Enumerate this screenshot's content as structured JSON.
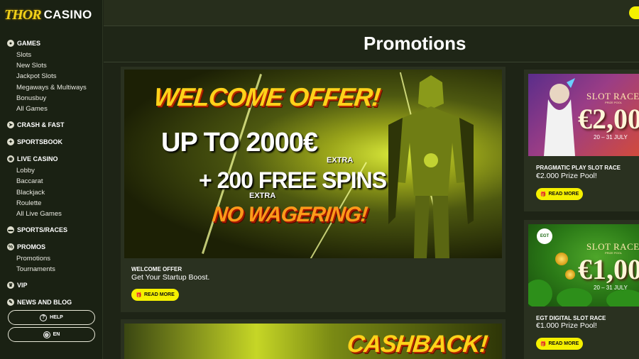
{
  "brand": {
    "logo_text_1": "THOR",
    "logo_text_2": "CASINO",
    "accent": "#f5f000"
  },
  "sidebar": {
    "sections": [
      {
        "label": "GAMES",
        "icon": "games-icon",
        "items": [
          "Slots",
          "New Slots",
          "Jackpot Slots",
          "Megaways & Multiways",
          "Bonusbuy",
          "All Games"
        ]
      },
      {
        "label": "CRASH & FAST",
        "icon": "rocket-icon",
        "items": []
      },
      {
        "label": "SPORTSBOOK",
        "icon": "sports-icon",
        "items": []
      },
      {
        "label": "LIVE CASINO",
        "icon": "live-casino-icon",
        "items": [
          "Lobby",
          "Baccarat",
          "Blackjack",
          "Roulette",
          "All Live Games"
        ]
      },
      {
        "label": "SPORTS/RACES",
        "icon": "races-icon",
        "items": []
      },
      {
        "label": "PROMOS",
        "icon": "promos-icon",
        "items": [
          "Promotions",
          "Tournaments"
        ]
      },
      {
        "label": "VIP",
        "icon": "vip-icon",
        "items": []
      },
      {
        "label": "NEWS AND BLOG",
        "icon": "news-icon",
        "items": []
      }
    ],
    "help_label": "HELP",
    "lang_label": "EN"
  },
  "page": {
    "title": "Promotions"
  },
  "promotions": [
    {
      "label": "WELCOME OFFER",
      "description": "Get Your Startup Boost.",
      "button": "READ MORE",
      "banner": {
        "headline": "WELCOME OFFER!",
        "line1": "UP TO 2000€",
        "line1_tag": "EXTRA",
        "line2": "+ 200 FREE SPINS",
        "line2_tag": "EXTRA",
        "line3": "NO WAGERING!"
      }
    },
    {
      "label": "",
      "description": "",
      "button": "",
      "banner": {
        "headline": "CASHBACK!"
      }
    }
  ],
  "races": [
    {
      "label": "PRAGMATIC PLAY SLOT RACE",
      "description": "€2.000 Prize Pool!",
      "button": "READ MORE",
      "banner": {
        "title": "SLOT RACE",
        "sub": "PRIZE POOL",
        "amount": "€2,00",
        "dates": "20 – 31 JULY"
      }
    },
    {
      "label": "EGT DIGITAL SLOT RACE",
      "description": "€1.000 Prize Pool!",
      "button": "READ MORE",
      "banner": {
        "title": "SLOT RACE",
        "sub": "PRIZE POOL",
        "amount": "€1,00",
        "dates": "20 – 31 JULY",
        "logo": "EGT"
      }
    }
  ]
}
